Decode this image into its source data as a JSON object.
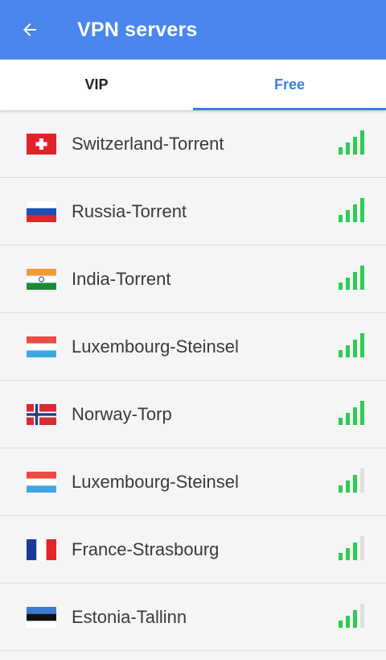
{
  "header": {
    "title": "VPN servers",
    "back_icon": "arrow-left-icon"
  },
  "tabs": [
    {
      "label": "VIP",
      "active": false
    },
    {
      "label": "Free",
      "active": true
    }
  ],
  "colors": {
    "appbar": "#4a86ec",
    "accent": "#3b7fe0",
    "signal_on": "#2ecc52",
    "signal_off": "#dedede"
  },
  "servers": [
    {
      "name": "Switzerland-Torrent",
      "flag": "switzerland-flag-icon",
      "signal_bars": 4
    },
    {
      "name": "Russia-Torrent",
      "flag": "russia-flag-icon",
      "signal_bars": 4
    },
    {
      "name": "India-Torrent",
      "flag": "india-flag-icon",
      "signal_bars": 4
    },
    {
      "name": "Luxembourg-Steinsel",
      "flag": "luxembourg-flag-icon",
      "signal_bars": 4
    },
    {
      "name": "Norway-Torp",
      "flag": "norway-flag-icon",
      "signal_bars": 4
    },
    {
      "name": "Luxembourg-Steinsel",
      "flag": "luxembourg-flag-icon",
      "signal_bars": 3
    },
    {
      "name": "France-Strasbourg",
      "flag": "france-flag-icon",
      "signal_bars": 3
    },
    {
      "name": "Estonia-Tallinn",
      "flag": "estonia-flag-icon",
      "signal_bars": 3
    }
  ]
}
